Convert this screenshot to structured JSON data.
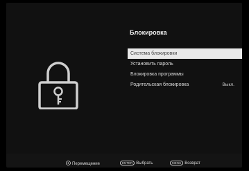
{
  "header": {
    "title": "Блокировка"
  },
  "menu": {
    "items": [
      {
        "label": "Система блокировки",
        "selected": true,
        "value": ""
      },
      {
        "label": "Установить пароль",
        "selected": false,
        "value": ""
      },
      {
        "label": "Блокировка программы",
        "selected": false,
        "value": ""
      },
      {
        "label": "Родительская блокировка",
        "selected": false,
        "value": "Выкл."
      }
    ]
  },
  "footer": {
    "move_label": "Перемещение",
    "enter_key": "ENTER",
    "select_label": "Выбрать",
    "menu_key": "MENU",
    "back_label": "Возврат"
  },
  "icons": {
    "lock": "padlock-key-icon",
    "move": "dpad-icon"
  },
  "colors": {
    "background": "#111111",
    "selected_bg": "#e9e9e9",
    "selected_text": "#444444"
  }
}
